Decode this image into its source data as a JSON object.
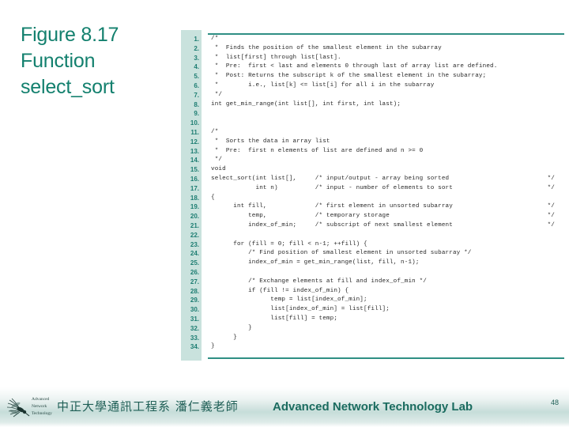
{
  "slide": {
    "title_lines": [
      "Figure 8.17",
      "Function",
      "select_sort"
    ],
    "accent_color": "#13806e",
    "rule_color": "#2f8f84",
    "gutter_color": "#c9e2dd"
  },
  "code": {
    "language": "c",
    "line_count": 34,
    "line_numbers": [
      "1.",
      "2.",
      "3.",
      "4.",
      "5.",
      "6.",
      "7.",
      "8.",
      "9.",
      "10.",
      "11.",
      "12.",
      "13.",
      "14.",
      "15.",
      "16.",
      "17.",
      "18.",
      "19.",
      "20.",
      "21.",
      "22.",
      "23.",
      "24.",
      "25.",
      "26.",
      "27.",
      "28.",
      "29.",
      "30.",
      "31.",
      "32.",
      "33.",
      "34."
    ],
    "lines": [
      {
        "n": "1.",
        "text": "/*",
        "end": ""
      },
      {
        "n": "2.",
        "text": " *  Finds the position of the smallest element in the subarray",
        "end": ""
      },
      {
        "n": "3.",
        "text": " *  list[first] through list[last].",
        "end": ""
      },
      {
        "n": "4.",
        "text": " *  Pre:  first < last and elements 0 through last of array list are defined.",
        "end": ""
      },
      {
        "n": "5.",
        "text": " *  Post: Returns the subscript k of the smallest element in the subarray;",
        "end": ""
      },
      {
        "n": "6.",
        "text": " *        i.e., list[k] <= list[i] for all i in the subarray",
        "end": ""
      },
      {
        "n": "7.",
        "text": " */",
        "end": ""
      },
      {
        "n": "8.",
        "text": "int get_min_range(int list[], int first, int last);",
        "end": ""
      },
      {
        "n": "9.",
        "text": "",
        "end": ""
      },
      {
        "n": "10.",
        "text": "",
        "end": ""
      },
      {
        "n": "11.",
        "text": "/*",
        "end": ""
      },
      {
        "n": "12.",
        "text": " *  Sorts the data in array list",
        "end": ""
      },
      {
        "n": "13.",
        "text": " *  Pre:  first n elements of list are defined and n >= 0",
        "end": ""
      },
      {
        "n": "14.",
        "text": " */",
        "end": ""
      },
      {
        "n": "15.",
        "text": "void",
        "end": ""
      },
      {
        "n": "16.",
        "text": "select_sort(int list[],     /* input/output - array being sorted",
        "end": "*/"
      },
      {
        "n": "17.",
        "text": "            int n)          /* input - number of elements to sort",
        "end": "*/"
      },
      {
        "n": "18.",
        "text": "{",
        "end": ""
      },
      {
        "n": "19.",
        "text": "      int fill,             /* first element in unsorted subarray",
        "end": "*/"
      },
      {
        "n": "20.",
        "text": "          temp,             /* temporary storage",
        "end": "*/"
      },
      {
        "n": "21.",
        "text": "          index_of_min;     /* subscript of next smallest element",
        "end": "*/"
      },
      {
        "n": "22.",
        "text": "",
        "end": ""
      },
      {
        "n": "23.",
        "text": "      for (fill = 0; fill < n-1; ++fill) {",
        "end": ""
      },
      {
        "n": "24.",
        "text": "          /* Find position of smallest element in unsorted subarray */",
        "end": ""
      },
      {
        "n": "25.",
        "text": "          index_of_min = get_min_range(list, fill, n-1);",
        "end": ""
      },
      {
        "n": "26.",
        "text": "",
        "end": ""
      },
      {
        "n": "27.",
        "text": "          /* Exchange elements at fill and index_of_min */",
        "end": ""
      },
      {
        "n": "28.",
        "text": "          if (fill != index_of_min) {",
        "end": ""
      },
      {
        "n": "29.",
        "text": "                temp = list[index_of_min];",
        "end": ""
      },
      {
        "n": "30.",
        "text": "                list[index_of_min] = list[fill];",
        "end": ""
      },
      {
        "n": "31.",
        "text": "                list[fill] = temp;",
        "end": ""
      },
      {
        "n": "32.",
        "text": "          }",
        "end": ""
      },
      {
        "n": "33.",
        "text": "      }",
        "end": ""
      },
      {
        "n": "34.",
        "text": "}",
        "end": ""
      }
    ]
  },
  "footer": {
    "logo_icon": "mosquito-icon",
    "logo_lines": [
      "Advanced",
      "Network",
      "Technology"
    ],
    "affiliation_cjk": "中正大學通訊工程系 潘仁義老師",
    "lab_name": "Advanced Network Technology Lab",
    "page_number": "48"
  }
}
